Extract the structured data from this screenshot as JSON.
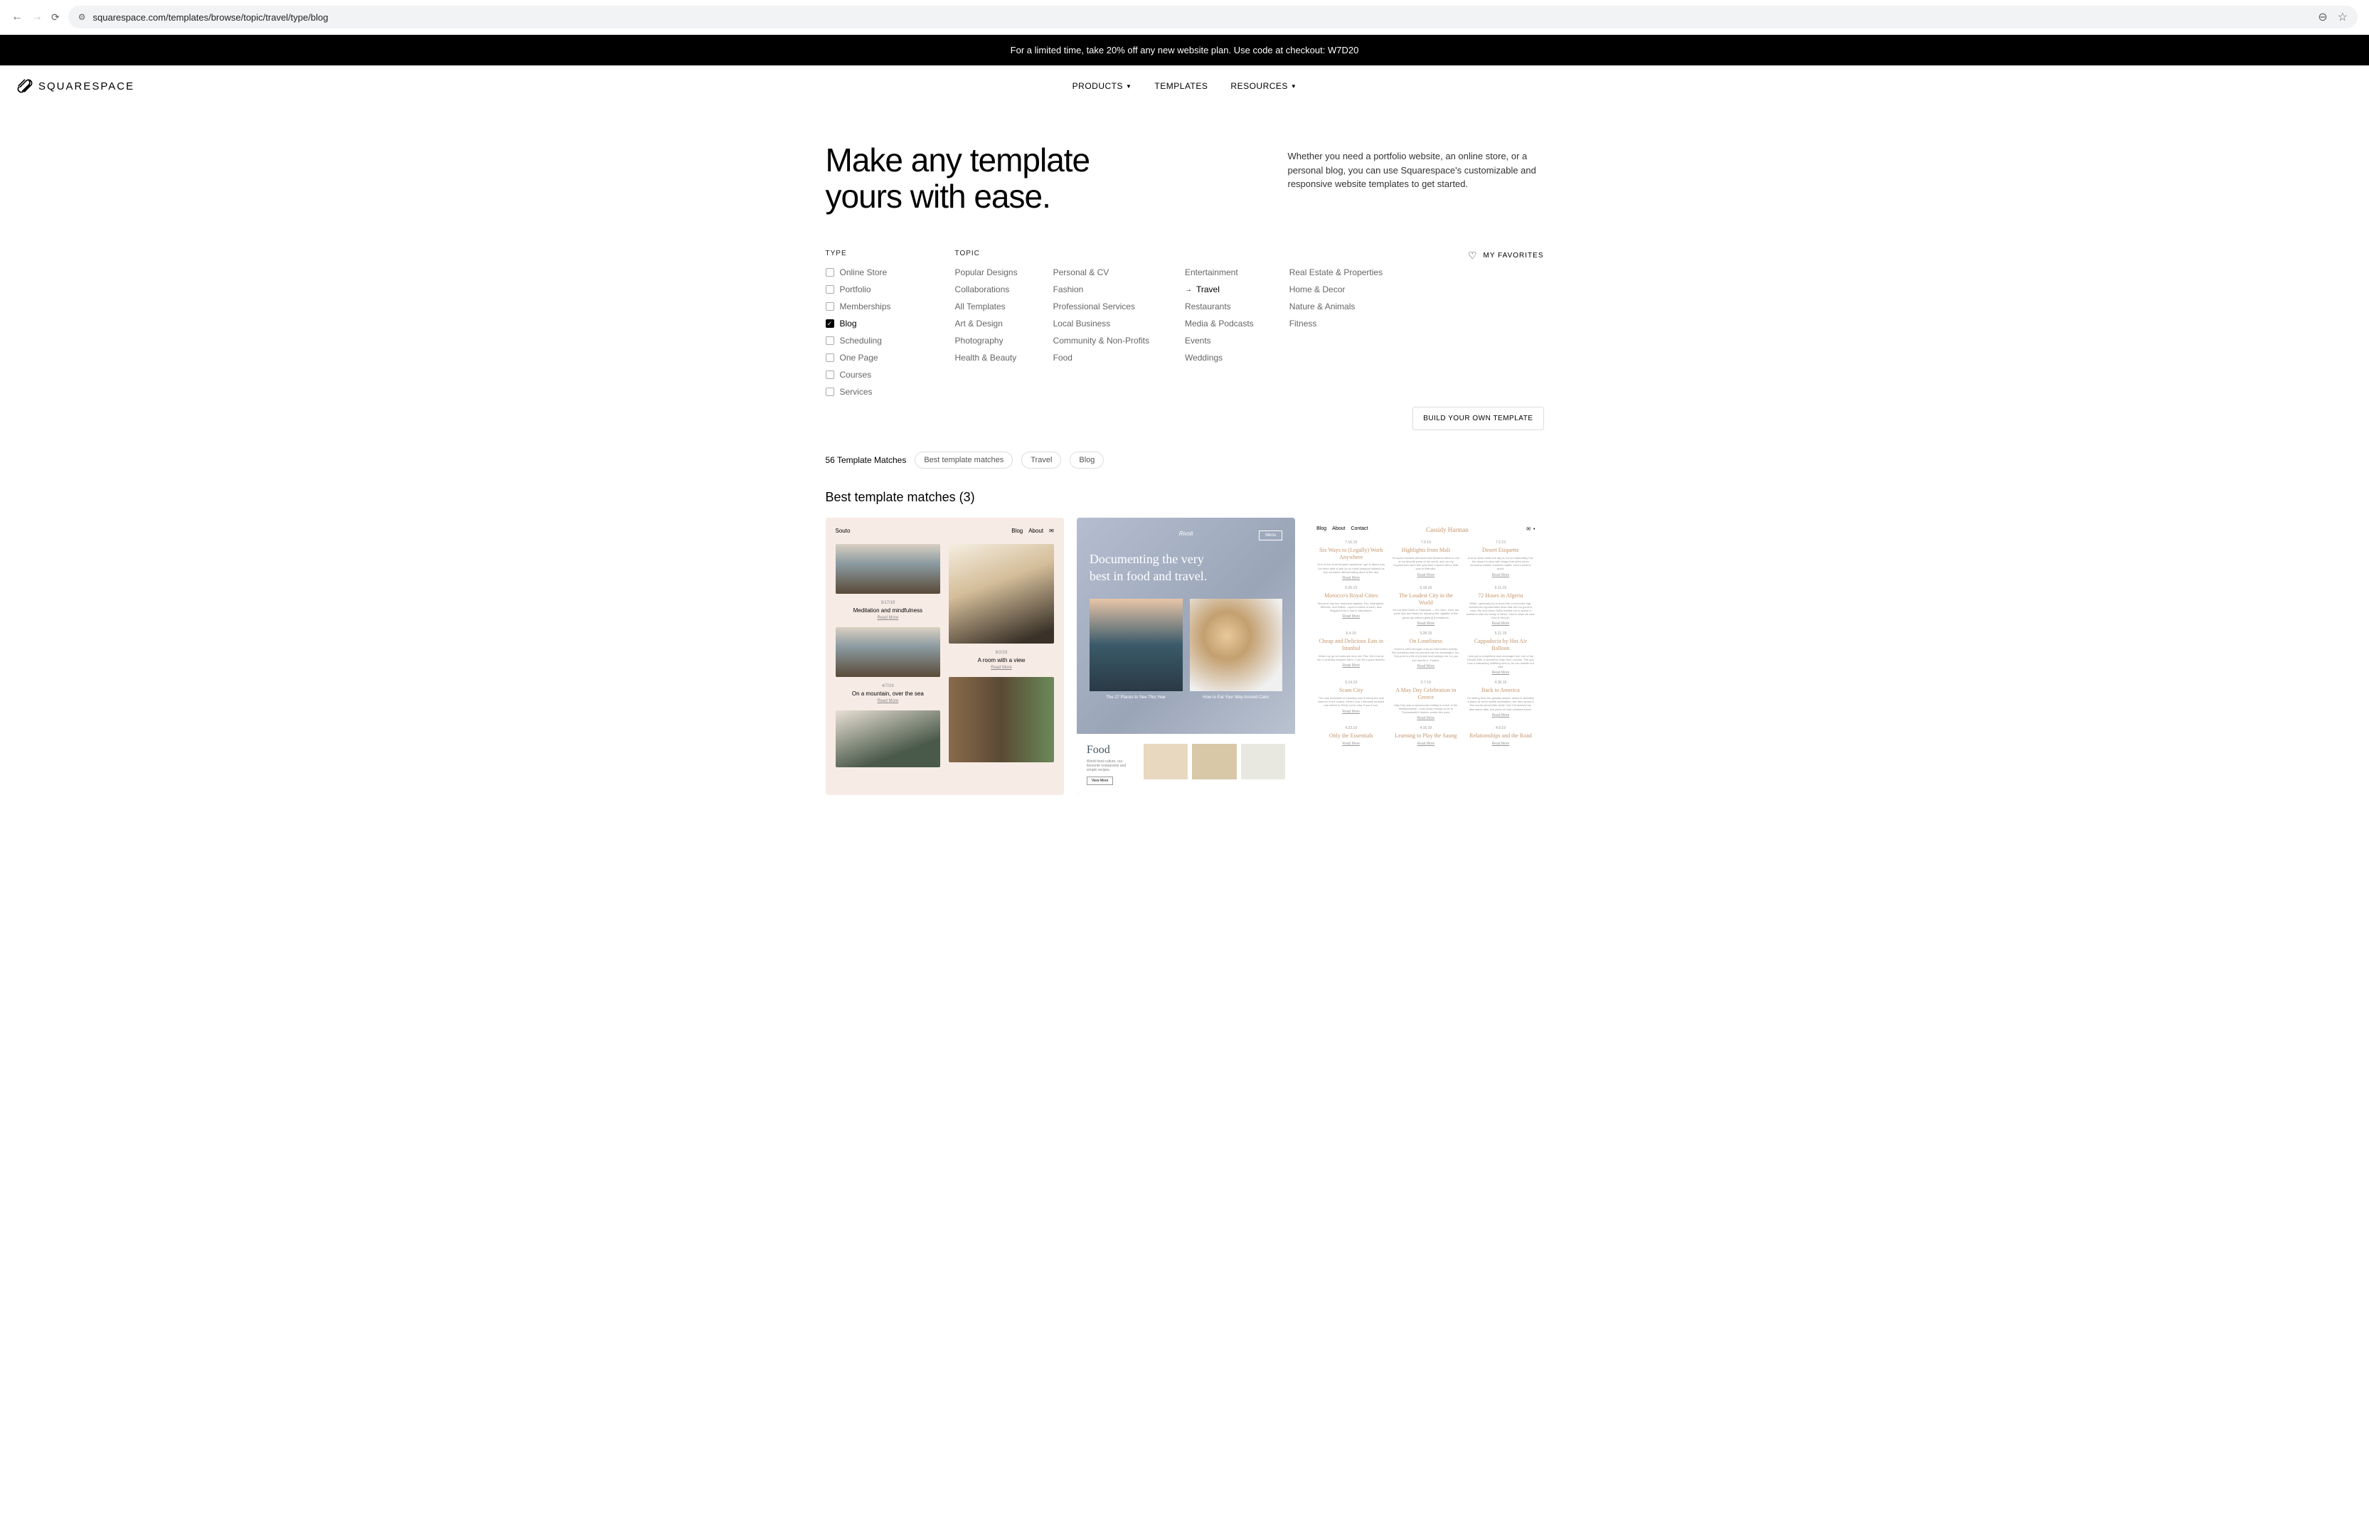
{
  "browser": {
    "url": "squarespace.com/templates/browse/topic/travel/type/blog"
  },
  "announcement": "For a limited time, take 20% off any new website plan. Use code at checkout: W7D20",
  "brand": "SQUARESPACE",
  "nav": {
    "products": "PRODUCTS",
    "templates": "TEMPLATES",
    "resources": "RESOURCES"
  },
  "hero": {
    "title_line1": "Make any template",
    "title_line2": "yours with ease.",
    "description": "Whether you need a portfolio website, an online store, or a personal blog, you can use Squarespace's customizable and responsive website templates to get started."
  },
  "filters": {
    "type_label": "TYPE",
    "topic_label": "TOPIC",
    "types": [
      {
        "label": "Online Store",
        "checked": false
      },
      {
        "label": "Portfolio",
        "checked": false
      },
      {
        "label": "Memberships",
        "checked": false
      },
      {
        "label": "Blog",
        "checked": true
      },
      {
        "label": "Scheduling",
        "checked": false
      },
      {
        "label": "One Page",
        "checked": false
      },
      {
        "label": "Courses",
        "checked": false
      },
      {
        "label": "Services",
        "checked": false
      }
    ],
    "topics": {
      "col1": [
        "Popular Designs",
        "Collaborations",
        "All Templates",
        "Art & Design",
        "Photography",
        "Health & Beauty"
      ],
      "col2": [
        "Personal & CV",
        "Fashion",
        "Professional Services",
        "Local Business",
        "Community & Non-Profits",
        "Food"
      ],
      "col3": [
        "Entertainment",
        "Travel",
        "Restaurants",
        "Media & Podcasts",
        "Events",
        "Weddings"
      ],
      "col4": [
        "Real Estate & Properties",
        "Home & Decor",
        "Nature & Animals",
        "Fitness"
      ]
    },
    "active_topic": "Travel"
  },
  "favorites_label": "MY FAVORITES",
  "build_button": "BUILD YOUR OWN TEMPLATE",
  "match_count": "56 Template Matches",
  "chips": [
    "Best template matches",
    "Travel",
    "Blog"
  ],
  "section_title": "Best template matches (3)",
  "templates": {
    "souto": {
      "name": "Souto",
      "nav": [
        "Blog",
        "About",
        "✉"
      ],
      "posts": [
        {
          "date": "3/17/19",
          "title": "Meditation and mindfulness",
          "link": "Read More"
        },
        {
          "date": "4/7/19",
          "title": "On a mountain, over the sea",
          "link": "Read More"
        },
        {
          "date": "6/2/19",
          "title": "A room with a view",
          "link": "Read More"
        }
      ]
    },
    "rivoli": {
      "brand": "Rivoli",
      "btn": "Menu",
      "headline": "Documenting the very best in food and travel.",
      "caps": [
        "The 27 Places to See This Year",
        "How to Eat Your Way Around Cairo"
      ],
      "food_title": "Food",
      "food_desc": "World food culture, our favourite restaurants and simple recipes.",
      "food_btn": "View More"
    },
    "cassidy": {
      "nav": [
        "Blog",
        "About",
        "Contact"
      ],
      "brand": "Cassidy Harman",
      "posts": [
        {
          "date": "7.16.19",
          "title": "Six Ways to (Legally) Work Anywhere",
          "text": "One of the most frequent questions I get is about how I've been able to pile up so many passport stamps as two countries without falling afoul of the law."
        },
        {
          "date": "7.9.19",
          "title": "Highlights from Mali",
          "text": "Frequent readers will know that Western Africa is one of my favorite parts of the world, and, as my experiences were this year that I haven't felt to Mali was to Bamako."
        },
        {
          "date": "7.2.19",
          "title": "Desert Etiquette",
          "text": "And so when while the day is not so unbearably hot, the desert is alive with things that often serve economic hidden customs matter, here's what to avoid."
        },
        {
          "date": "6.25.19",
          "title": "Morocco's Royal Cities",
          "text": "Morocco has four historical capitals: Fès, Marrakesh, Meknès, and Rabat. I spent a week in each, and blogged from a riad in Marrakesh."
        },
        {
          "date": "6.18.19",
          "title": "The Loudest City in the World",
          "text": "It's not New Delhi or Shanghai — it's Cairo. Here are some tips and tricks for enjoying the nightlife of this great city without getting a headache."
        },
        {
          "date": "6.11.19",
          "title": "72 Hours in Algeria",
          "text": "While I generally try to avoid the cool-hunter trap, sometimes opportunities arise that are too good to miss. My new friend Zahid invited me to spend a weekend with his family in Beirut. Here's what we saw. God is Simple."
        },
        {
          "date": "6.4.19",
          "title": "Cheap and Delicious Eats in Istanbul",
          "text": "When my go-to foods are very old. Pita. We'd eat at our in-ordinary temples there; I can be a good teacher."
        },
        {
          "date": "5.28.19",
          "title": "On Loneliness",
          "text": "Travel is often thought of as an extroverted activity. But spending time by yourself can be meaningful, too. This post is a bit of a break and ranting one; be you can handle it. Thanks."
        },
        {
          "date": "5.21.19",
          "title": "Cappadocia by Hot Air Balloon",
          "text": "I just got a completely new message from one of my friends Alfie, a wonderful chap from London. The guy runs a ballooning outfitting new so he can whistle out east."
        },
        {
          "date": "5.14.19",
          "title": "Scam City",
          "text": "The only downside of traveling solo is being the sole witness of the scams. Here's how I narrowly avoided one where to Petra not to miss if you if can."
        },
        {
          "date": "5.7.19",
          "title": "A May Day Celebration in Greece",
          "text": "May Day was a spectacular holiday in much of the Mediterranean. I was lucky enough to be in Thessaloniki's historic center this year."
        },
        {
          "date": "4.30.19",
          "title": "Back to America",
          "text": "I'm writing from the globally airport, which is definitely a plane at some visible destination, are they spoke a few words about After what I feel I've learned my alternative after two years of near-constant travel."
        },
        {
          "date": "4.23.19",
          "title": "Only the Essentials",
          "text": ""
        },
        {
          "date": "4.16.19",
          "title": "Learning to Play the Saung",
          "text": ""
        },
        {
          "date": "4.9.19",
          "title": "Relationships and the Road",
          "text": ""
        }
      ]
    }
  }
}
